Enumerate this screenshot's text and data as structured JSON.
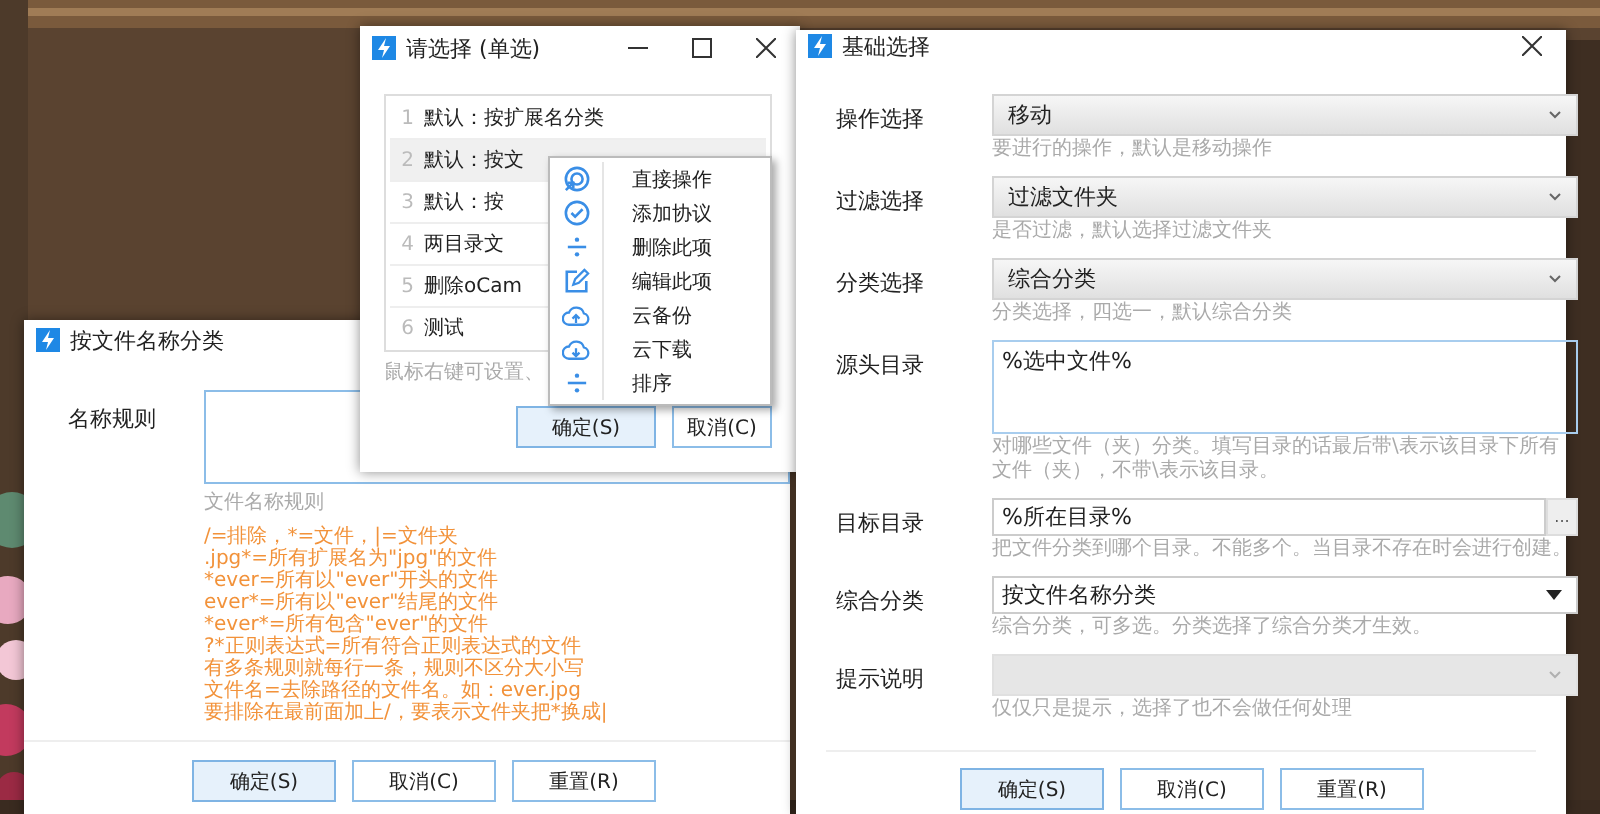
{
  "classify_window": {
    "title": "按文件名称分类",
    "rule_label": "名称规则",
    "rule_hint": "文件名称规则",
    "help_lines": [
      "/=排除，*=文件，|=文件夹",
      ".jpg*=所有扩展名为\"jpg\"的文件",
      "*ever=所有以\"ever\"开头的文件",
      "ever*=所有以\"ever\"结尾的文件",
      "*ever*=所有包含\"ever\"的文件",
      "?*正则表达式=所有符合正则表达式的文件",
      "有多条规则就每行一条，规则不区分大小写",
      "文件名=去除路径的文件名。如：ever.jpg",
      "要排除在最前面加上/，要表示文件夹把*换成|"
    ],
    "buttons": [
      {
        "label": "确定(S)",
        "primary": true
      },
      {
        "label": "取消(C)",
        "primary": false
      },
      {
        "label": "重置(R)",
        "primary": false
      }
    ]
  },
  "select_window": {
    "title": "请选择 (单选)",
    "items": [
      {
        "number": "1",
        "text": "默认：按扩展名分类",
        "selected": false
      },
      {
        "number": "2",
        "text": "默认：按文",
        "selected": true
      },
      {
        "number": "3",
        "text": "默认：按",
        "selected": false
      },
      {
        "number": "4",
        "text": "两目录文",
        "selected": false
      },
      {
        "number": "5",
        "text": "删除oCam",
        "selected": false
      },
      {
        "number": "6",
        "text": "测试",
        "selected": false
      }
    ],
    "hint": "鼠标右键可设置、",
    "buttons": [
      {
        "label": "确定(S)",
        "primary": true
      },
      {
        "label": "取消(C)",
        "primary": false
      }
    ]
  },
  "context_menu": {
    "items": [
      {
        "kind": "target",
        "label": "直接操作"
      },
      {
        "kind": "check",
        "label": "添加协议"
      },
      {
        "kind": "divide",
        "label": "删除此项"
      },
      {
        "kind": "edit",
        "label": "编辑此项"
      },
      {
        "kind": "upload",
        "label": "云备份"
      },
      {
        "kind": "download",
        "label": "云下载"
      },
      {
        "kind": "divide",
        "label": "排序"
      }
    ]
  },
  "basic_window": {
    "title": "基础选择",
    "fields": [
      {
        "kind": "select",
        "label": "操作选择",
        "value": "移动",
        "hint": "要进行的操作，默认是移动操作",
        "disabled": false
      },
      {
        "kind": "select",
        "label": "过滤选择",
        "value": "过滤文件夹",
        "hint": "是否过滤，默认选择过滤文件夹",
        "disabled": false
      },
      {
        "kind": "select",
        "label": "分类选择",
        "value": "综合分类",
        "hint": "分类选择，四选一，默认综合分类",
        "disabled": false
      },
      {
        "kind": "textarea",
        "label": "源头目录",
        "value": "%选中文件%",
        "hint": "对哪些文件（夹）分类。填写目录的话最后带\\表示该目录下所有文件（夹），不带\\表示该目录。"
      },
      {
        "kind": "browse",
        "label": "目标目录",
        "value": "%所在目录%",
        "browse": "...",
        "hint": "把文件分类到哪个目录。不能多个。当目录不存在时会进行创建。"
      },
      {
        "kind": "dropdown",
        "label": "综合分类",
        "value": "按文件名称分类",
        "hint": "综合分类，可多选。分类选择了综合分类才生效。"
      },
      {
        "kind": "select",
        "label": "提示说明",
        "hint": "仅仅只是提示，选择了也不会做任何处理",
        "disabled": true
      }
    ],
    "buttons": [
      {
        "label": "确定(S)",
        "primary": true
      },
      {
        "label": "取消(C)",
        "primary": false
      },
      {
        "label": "重置(R)",
        "primary": false
      }
    ]
  }
}
